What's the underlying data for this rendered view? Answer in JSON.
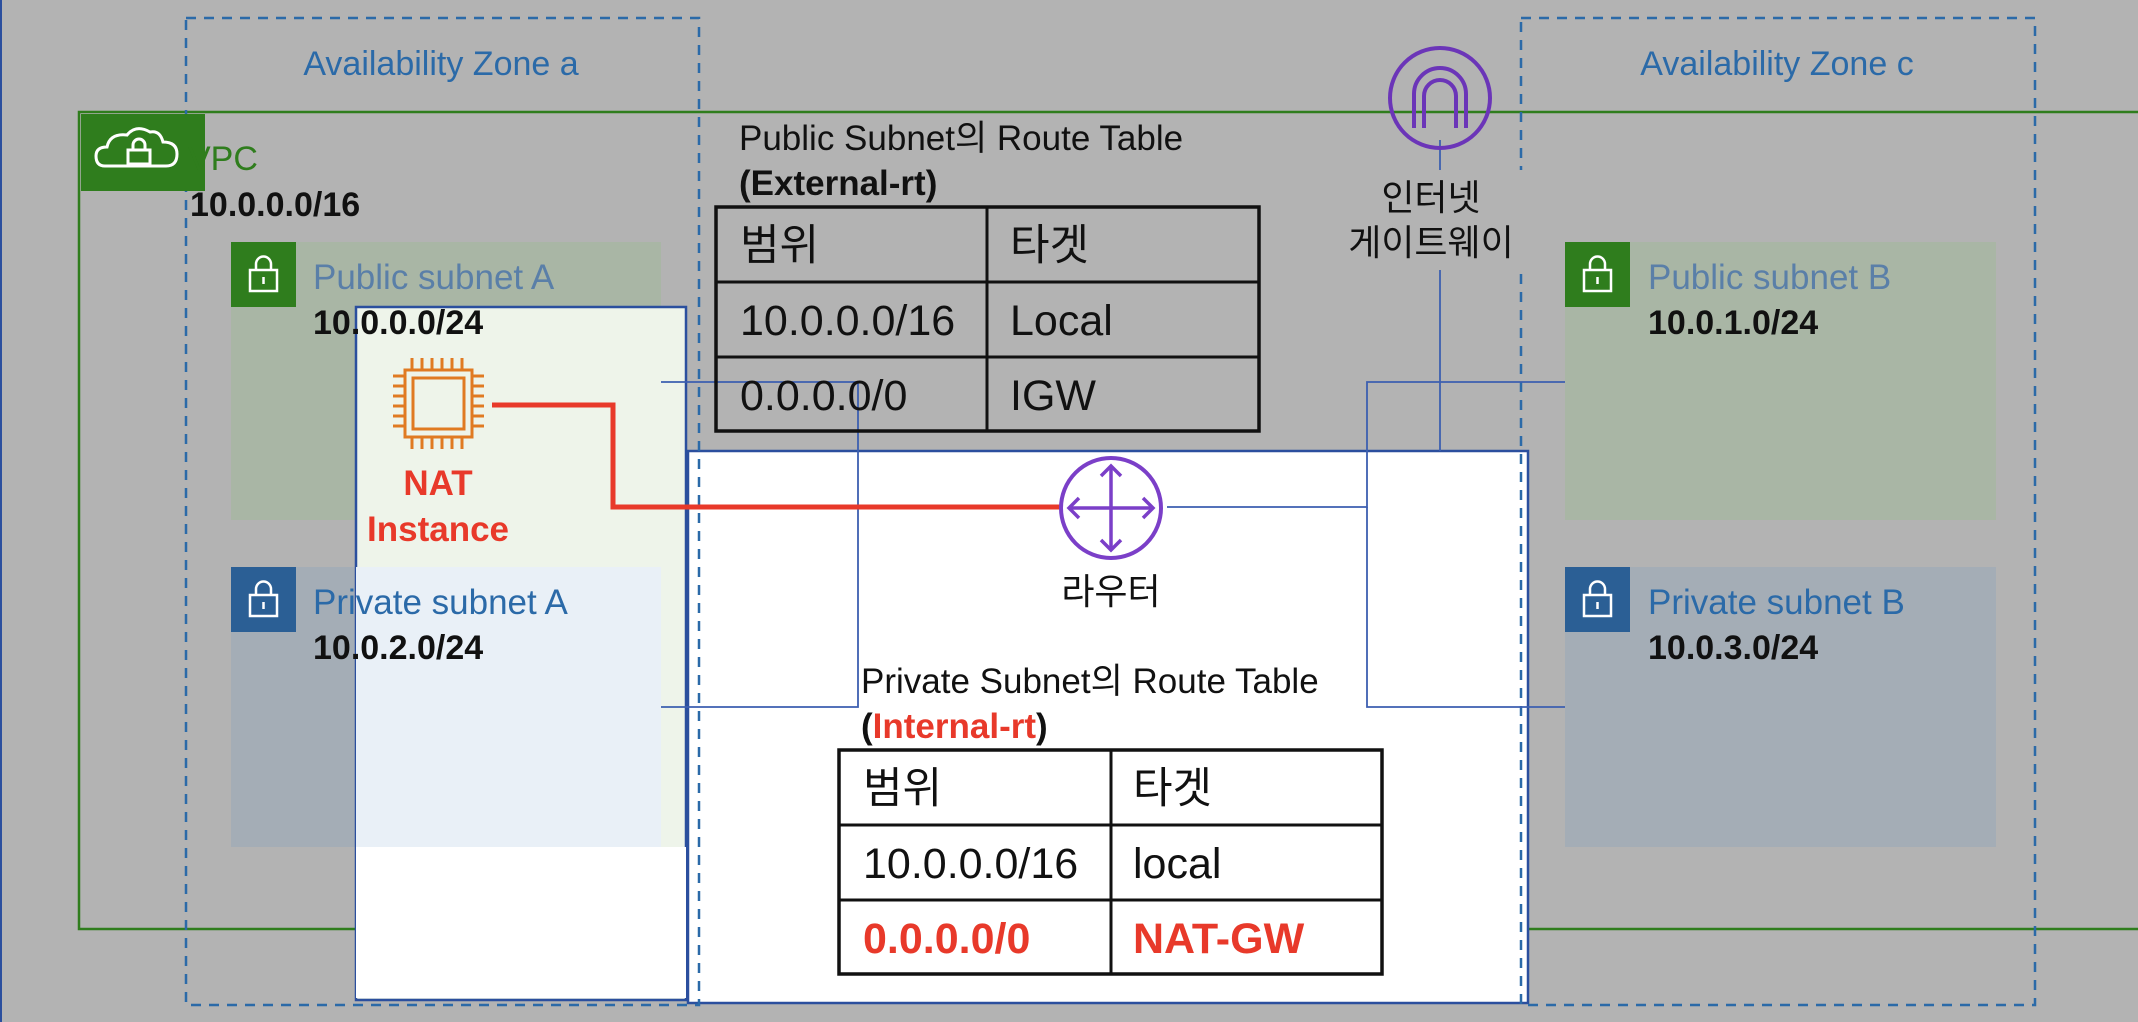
{
  "zones": {
    "a_label": "Availability Zone a",
    "c_label": "Availability Zone c"
  },
  "vpc": {
    "label": "VPC",
    "cidr": "10.0.0.0/16"
  },
  "subnets": {
    "public_a": {
      "name": "Public subnet A",
      "cidr": "10.0.0.0/24"
    },
    "private_a": {
      "name": "Private subnet A",
      "cidr": "10.0.2.0/24"
    },
    "public_b": {
      "name": "Public subnet B",
      "cidr": "10.0.1.0/24"
    },
    "private_b": {
      "name": "Private subnet B",
      "cidr": "10.0.3.0/24"
    }
  },
  "public_route_table": {
    "title": "Public Subnet의 Route Table",
    "name_prefix": "(",
    "name": "External-rt",
    "name_suffix": ")",
    "headers": [
      "범위",
      "타겟"
    ],
    "rows": [
      [
        "10.0.0.0/16",
        "Local"
      ],
      [
        "0.0.0.0/0",
        "IGW"
      ]
    ]
  },
  "private_route_table": {
    "title": "Private Subnet의 Route Table",
    "name_prefix": "(",
    "name": "Internal-rt",
    "name_suffix": ")",
    "headers": [
      "범위",
      "타겟"
    ],
    "rows": [
      [
        "10.0.0.0/16",
        "local"
      ],
      [
        "0.0.0.0/0",
        "NAT-GW"
      ]
    ]
  },
  "nat": {
    "line1": "NAT",
    "line2": "Instance"
  },
  "router": {
    "label": "라우터"
  },
  "igw": {
    "line1": "인터넷",
    "line2": "게이트웨이"
  },
  "colors": {
    "background": "#b3b3b3",
    "vpc_green": "#2f7d1d",
    "zone_blue": "#2b6aa8",
    "accent_red": "#e8392a",
    "router_purple": "#7b3fc8"
  }
}
